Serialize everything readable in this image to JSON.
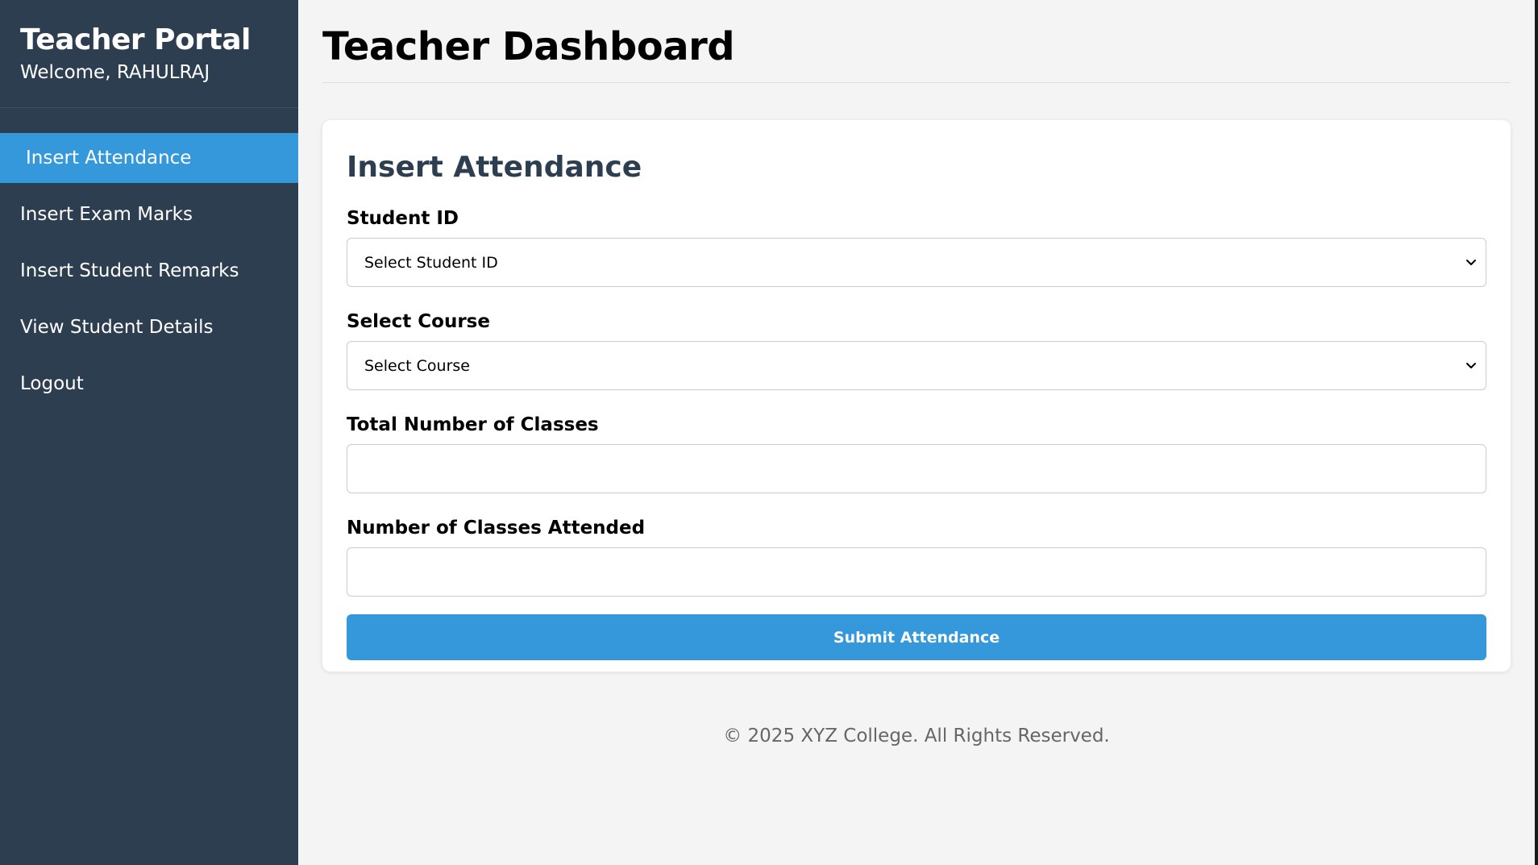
{
  "sidebar": {
    "brand": "Teacher Portal",
    "welcome": "Welcome, RAHULRAJ",
    "items": [
      {
        "label": "Insert Attendance",
        "active": true
      },
      {
        "label": "Insert Exam Marks",
        "active": false
      },
      {
        "label": "Insert Student Remarks",
        "active": false
      },
      {
        "label": "View Student Details",
        "active": false
      },
      {
        "label": "Logout",
        "active": false
      }
    ]
  },
  "main": {
    "title": "Teacher Dashboard",
    "form": {
      "title": "Insert Attendance",
      "student_id": {
        "label": "Student ID",
        "selected": "Select Student ID"
      },
      "course": {
        "label": "Select Course",
        "selected": "Select Course"
      },
      "total_classes": {
        "label": "Total Number of Classes",
        "value": "",
        "placeholder": ""
      },
      "attended_classes": {
        "label": "Number of Classes Attended",
        "value": "",
        "placeholder": ""
      },
      "submit_label": "Submit Attendance"
    },
    "footer": "© 2025 XYZ College. All Rights Reserved."
  },
  "colors": {
    "sidebar_bg": "#2c3e50",
    "accent": "#3498db",
    "page_bg": "#f4f4f4",
    "card_title": "#2c3e50"
  },
  "icons": {
    "select_arrow": "chevron-down-icon"
  }
}
